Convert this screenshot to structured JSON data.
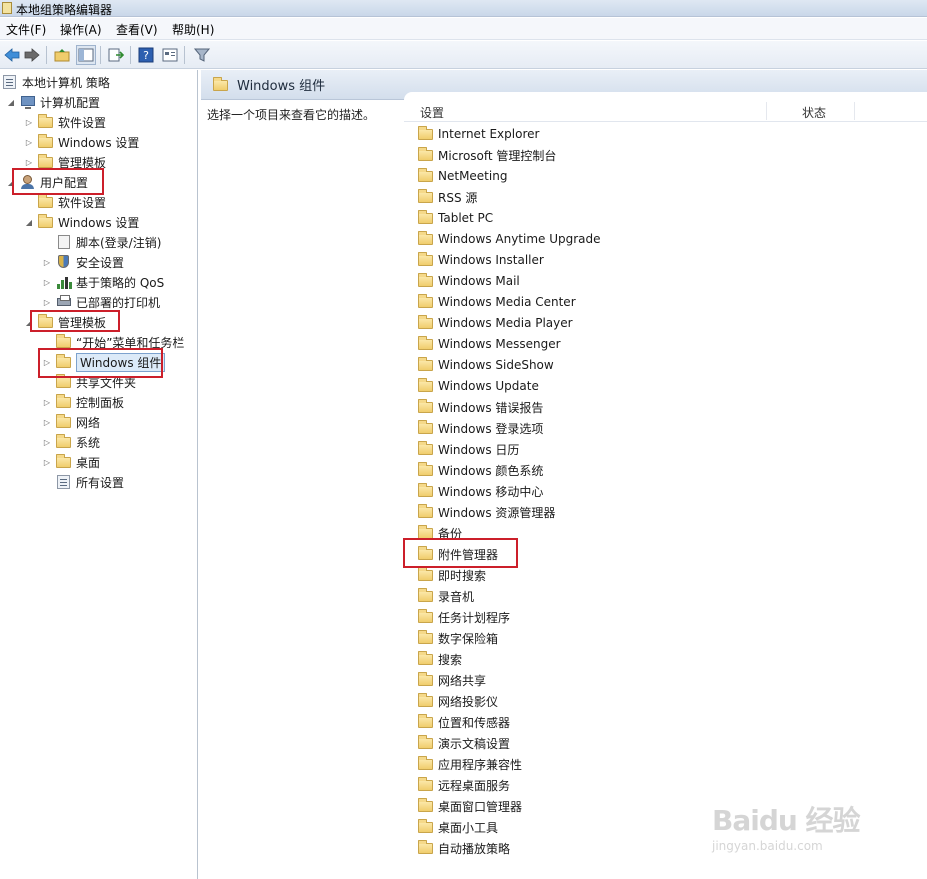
{
  "window": {
    "title": "本地组策略编辑器"
  },
  "menu": [
    "文件(F)",
    "操作(A)",
    "查看(V)",
    "帮助(H)"
  ],
  "toolbar": {
    "buttons": [
      "back-arrow-icon",
      "forward-arrow-icon",
      "up-folder-icon",
      "show-hide-tree-icon",
      "export-list-icon",
      "help-icon",
      "properties-icon",
      "filter-icon"
    ]
  },
  "tree": [
    {
      "label": "本地计算机 策略",
      "icon": "policy",
      "expander": ""
    },
    {
      "label": "计算机配置",
      "icon": "computer",
      "expander": "◢"
    },
    {
      "label": "软件设置",
      "icon": "folder",
      "expander": "▷"
    },
    {
      "label": "Windows 设置",
      "icon": "folder",
      "expander": "▷"
    },
    {
      "label": "管理模板",
      "icon": "folder",
      "expander": "▷"
    },
    {
      "label": "用户配置",
      "icon": "user",
      "expander": "◢"
    },
    {
      "label": "软件设置",
      "icon": "folder",
      "expander": ""
    },
    {
      "label": "Windows 设置",
      "icon": "folder",
      "expander": "◢"
    },
    {
      "label": "脚本(登录/注销)",
      "icon": "script",
      "expander": ""
    },
    {
      "label": "安全设置",
      "icon": "shield",
      "expander": "▷"
    },
    {
      "label": "基于策略的 QoS",
      "icon": "bars",
      "expander": "▷"
    },
    {
      "label": "已部署的打印机",
      "icon": "printer",
      "expander": "▷"
    },
    {
      "label": "管理模板",
      "icon": "folder",
      "expander": "◢"
    },
    {
      "label": "“开始”菜单和任务栏",
      "icon": "folder",
      "expander": ""
    },
    {
      "label": "Windows 组件",
      "icon": "folder",
      "expander": "▷"
    },
    {
      "label": "共享文件夹",
      "icon": "folder",
      "expander": ""
    },
    {
      "label": "控制面板",
      "icon": "folder",
      "expander": "▷"
    },
    {
      "label": "网络",
      "icon": "folder",
      "expander": "▷"
    },
    {
      "label": "系统",
      "icon": "folder",
      "expander": "▷"
    },
    {
      "label": "桌面",
      "icon": "folder",
      "expander": "▷"
    },
    {
      "label": "所有设置",
      "icon": "policy",
      "expander": ""
    }
  ],
  "right_pane": {
    "header_title": "Windows 组件",
    "description": "选择一个项目来查看它的描述。",
    "columns": {
      "setting": "设置",
      "state": "状态"
    },
    "items": [
      "Internet Explorer",
      "Microsoft 管理控制台",
      "NetMeeting",
      "RSS 源",
      "Tablet PC",
      "Windows Anytime Upgrade",
      "Windows Installer",
      "Windows Mail",
      "Windows Media Center",
      "Windows Media Player",
      "Windows Messenger",
      "Windows SideShow",
      "Windows Update",
      "Windows 错误报告",
      "Windows 登录选项",
      "Windows 日历",
      "Windows 颜色系统",
      "Windows 移动中心",
      "Windows 资源管理器",
      "备份",
      "附件管理器",
      "即时搜索",
      "录音机",
      "任务计划程序",
      "数字保险箱",
      "搜索",
      "网络共享",
      "网络投影仪",
      "位置和传感器",
      "演示文稿设置",
      "应用程序兼容性",
      "远程桌面服务",
      "桌面窗口管理器",
      "桌面小工具",
      "自动播放策略"
    ]
  },
  "watermark": {
    "logo": "Baidu 经验",
    "url": "jingyan.baidu.com"
  },
  "colors": {
    "highlight_red": "#cc1f2a",
    "selection_blue": "#dceaf8"
  }
}
